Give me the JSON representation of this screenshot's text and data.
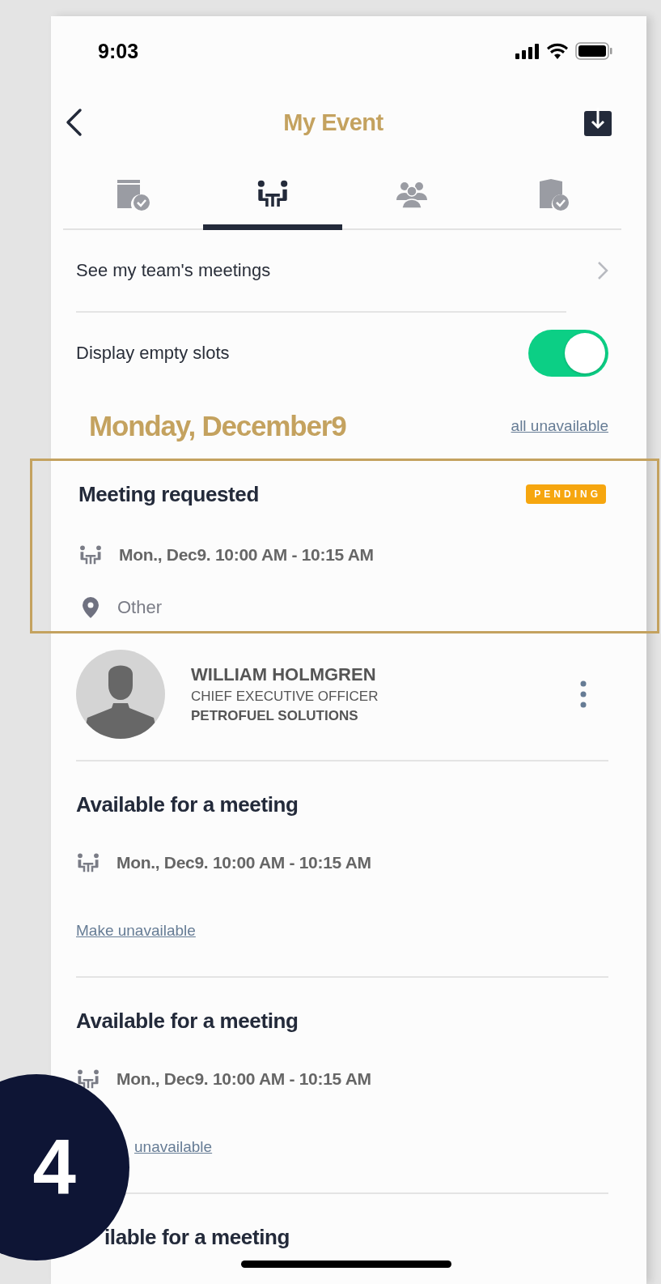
{
  "status_bar": {
    "time": "9:03"
  },
  "header": {
    "title": "My Event"
  },
  "tabs": [
    {
      "kind": "calendar",
      "selected": false
    },
    {
      "kind": "meeting",
      "selected": true
    },
    {
      "kind": "people",
      "selected": false
    },
    {
      "kind": "building",
      "selected": false
    }
  ],
  "team_link": {
    "label": "See my team's meetings"
  },
  "empty_slots": {
    "label": "Display empty slots",
    "on": true
  },
  "day": {
    "heading": "Monday, December9",
    "action": "all unavailable"
  },
  "request": {
    "title": "Meeting requested",
    "badge": "PENDING",
    "time": "Mon., Dec9. 10:00 AM - 10:15 AM",
    "location": "Other",
    "highlighted": true
  },
  "person": {
    "name": "WILLIAM HOLMGREN",
    "role": "CHIEF EXECUTIVE OFFICER",
    "company": "PETROFUEL SOLUTIONS"
  },
  "slots": [
    {
      "title": "Available for a meeting",
      "time": "Mon., Dec9. 10:00 AM - 10:15 AM",
      "action": "Make unavailable",
      "covered": false
    },
    {
      "title": "Available for a meeting",
      "time": "Mon., Dec9. 10:00 AM - 10:15 AM",
      "action": "unavailable",
      "covered": true
    },
    {
      "title": "ilable for a meeting",
      "covered": true
    }
  ],
  "step_badge": "4"
}
